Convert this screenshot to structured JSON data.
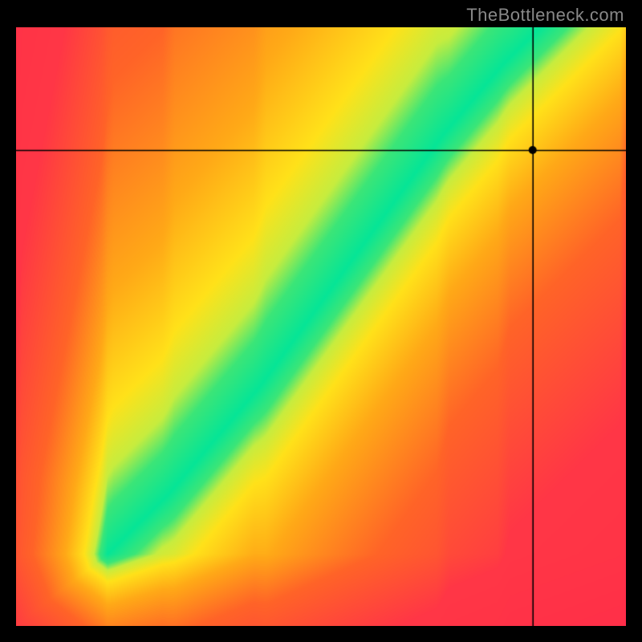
{
  "watermark": "TheBottleneck.com",
  "chart_data": {
    "type": "heatmap",
    "title": "",
    "xlabel": "",
    "ylabel": "",
    "xlim": [
      0,
      1
    ],
    "ylim": [
      0,
      1
    ],
    "crosshair": {
      "x": 0.847,
      "y": 0.795
    },
    "optimal_curve": {
      "description": "Green ridge indicating optimal pairing; heat falls off toward red away from it",
      "x": [
        0.0,
        0.05,
        0.1,
        0.15,
        0.2,
        0.25,
        0.3,
        0.35,
        0.4,
        0.45,
        0.5,
        0.55,
        0.6,
        0.65,
        0.7,
        0.75,
        0.8,
        0.85,
        0.9,
        0.95,
        1.0
      ],
      "y": [
        0.0,
        0.04,
        0.08,
        0.12,
        0.17,
        0.22,
        0.28,
        0.34,
        0.4,
        0.47,
        0.54,
        0.61,
        0.68,
        0.75,
        0.82,
        0.88,
        0.94,
        0.99,
        1.04,
        1.09,
        1.14
      ]
    },
    "bands": [
      {
        "name": "green-core",
        "half_width": 0.035,
        "color": "#06e597"
      },
      {
        "name": "green-yellow",
        "half_width": 0.07,
        "color": "#c7ed3f"
      },
      {
        "name": "yellow",
        "half_width": 0.14,
        "color": "#ffe21a"
      },
      {
        "name": "orange",
        "half_width": 0.3,
        "color": "#ff9a17"
      },
      {
        "name": "red",
        "half_width": 1.2,
        "color": "#ff2b4a"
      }
    ],
    "corner_hints": {
      "top_left": "red",
      "bottom_left": "red",
      "top_right": "yellow-orange",
      "bottom_right": "red-orange"
    }
  }
}
